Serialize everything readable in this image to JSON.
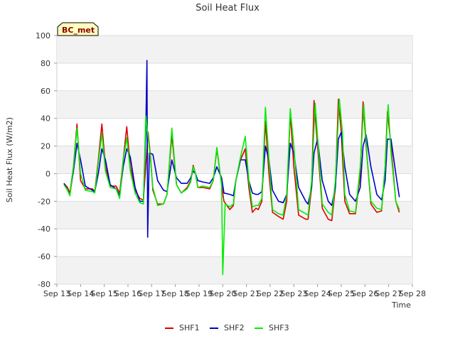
{
  "chart_data": {
    "type": "line",
    "title": "Soil Heat Flux",
    "xlabel": "Time",
    "ylabel": "Soil Heat Flux (W/m2)",
    "site_label": "BC_met",
    "xlim": [
      13,
      28
    ],
    "ylim": [
      -80,
      100
    ],
    "x_ticks": [
      {
        "x": 13,
        "label": "Sep 13"
      },
      {
        "x": 14,
        "label": "Sep 14"
      },
      {
        "x": 15,
        "label": "Sep 15"
      },
      {
        "x": 16,
        "label": "Sep 16"
      },
      {
        "x": 17,
        "label": "Sep 17"
      },
      {
        "x": 18,
        "label": "Sep 18"
      },
      {
        "x": 19,
        "label": "Sep 19"
      },
      {
        "x": 20,
        "label": "Sep 20"
      },
      {
        "x": 21,
        "label": "Sep 21"
      },
      {
        "x": 22,
        "label": "Sep 22"
      },
      {
        "x": 23,
        "label": "Sep 23"
      },
      {
        "x": 24,
        "label": "Sep 24"
      },
      {
        "x": 25,
        "label": "Sep 25"
      },
      {
        "x": 26,
        "label": "Sep 26"
      },
      {
        "x": 27,
        "label": "Sep 27"
      },
      {
        "x": 28,
        "label": "Sep 28"
      }
    ],
    "y_ticks": [
      {
        "y": -80,
        "label": "-80"
      },
      {
        "y": -60,
        "label": "-60"
      },
      {
        "y": -40,
        "label": "-40"
      },
      {
        "y": -20,
        "label": "-20"
      },
      {
        "y": 0,
        "label": "0"
      },
      {
        "y": 20,
        "label": "20"
      },
      {
        "y": 40,
        "label": "40"
      },
      {
        "y": 60,
        "label": "60"
      },
      {
        "y": 80,
        "label": "80"
      },
      {
        "y": 100,
        "label": "100"
      }
    ],
    "grid": true,
    "legend_position": "bottom-center",
    "series": [
      {
        "name": "SHF1",
        "color": "#dd0000",
        "points": [
          [
            13.3,
            -7
          ],
          [
            13.45,
            -10
          ],
          [
            13.55,
            -14
          ],
          [
            13.7,
            5
          ],
          [
            13.85,
            36
          ],
          [
            14.0,
            -5
          ],
          [
            14.2,
            -11
          ],
          [
            14.5,
            -11
          ],
          [
            14.6,
            -13
          ],
          [
            14.75,
            10
          ],
          [
            14.9,
            36
          ],
          [
            15.05,
            5
          ],
          [
            15.25,
            -9
          ],
          [
            15.5,
            -9
          ],
          [
            15.65,
            -14
          ],
          [
            15.8,
            10
          ],
          [
            15.95,
            34
          ],
          [
            16.1,
            5
          ],
          [
            16.3,
            -12
          ],
          [
            16.5,
            -18
          ],
          [
            16.65,
            -19
          ],
          [
            16.75,
            5
          ],
          [
            16.85,
            30
          ],
          [
            16.95,
            12
          ],
          [
            17.05,
            -12
          ],
          [
            17.25,
            -22
          ],
          [
            17.5,
            -22
          ],
          [
            17.65,
            -15
          ],
          [
            17.85,
            28
          ],
          [
            18.05,
            -8
          ],
          [
            18.25,
            -14
          ],
          [
            18.5,
            -10
          ],
          [
            18.65,
            -5
          ],
          [
            18.75,
            6
          ],
          [
            18.85,
            0
          ],
          [
            18.95,
            -10
          ],
          [
            19.15,
            -10
          ],
          [
            19.45,
            -11
          ],
          [
            19.6,
            -5
          ],
          [
            19.75,
            18
          ],
          [
            19.95,
            -8
          ],
          [
            20.05,
            -20
          ],
          [
            20.3,
            -26
          ],
          [
            20.45,
            -23
          ],
          [
            20.55,
            -5
          ],
          [
            20.75,
            10
          ],
          [
            20.95,
            18
          ],
          [
            21.1,
            -10
          ],
          [
            21.25,
            -28
          ],
          [
            21.4,
            -25
          ],
          [
            21.5,
            -26
          ],
          [
            21.65,
            -20
          ],
          [
            21.8,
            38
          ],
          [
            21.95,
            0
          ],
          [
            22.1,
            -28
          ],
          [
            22.35,
            -31
          ],
          [
            22.55,
            -33
          ],
          [
            22.7,
            -20
          ],
          [
            22.85,
            44
          ],
          [
            23.0,
            5
          ],
          [
            23.2,
            -30
          ],
          [
            23.5,
            -33
          ],
          [
            23.6,
            -33
          ],
          [
            23.75,
            -10
          ],
          [
            23.85,
            53
          ],
          [
            24.0,
            20
          ],
          [
            24.2,
            -25
          ],
          [
            24.45,
            -33
          ],
          [
            24.6,
            -34
          ],
          [
            24.75,
            -10
          ],
          [
            24.88,
            54
          ],
          [
            25.0,
            30
          ],
          [
            25.15,
            -20
          ],
          [
            25.35,
            -29
          ],
          [
            25.6,
            -29
          ],
          [
            25.8,
            0
          ],
          [
            25.92,
            52
          ],
          [
            26.05,
            20
          ],
          [
            26.25,
            -22
          ],
          [
            26.5,
            -28
          ],
          [
            26.7,
            -27
          ],
          [
            26.85,
            5
          ],
          [
            26.95,
            45
          ],
          [
            27.1,
            20
          ],
          [
            27.3,
            -20
          ],
          [
            27.45,
            -28
          ]
        ]
      },
      {
        "name": "SHF2",
        "color": "#0000cc",
        "points": [
          [
            13.3,
            -7
          ],
          [
            13.45,
            -12
          ],
          [
            13.55,
            -15
          ],
          [
            13.7,
            2
          ],
          [
            13.85,
            22
          ],
          [
            14.0,
            10
          ],
          [
            14.2,
            -9
          ],
          [
            14.5,
            -12
          ],
          [
            14.6,
            -13
          ],
          [
            14.75,
            0
          ],
          [
            14.9,
            18
          ],
          [
            15.05,
            10
          ],
          [
            15.25,
            -8
          ],
          [
            15.5,
            -11
          ],
          [
            15.65,
            -16
          ],
          [
            15.8,
            5
          ],
          [
            15.95,
            18
          ],
          [
            16.1,
            12
          ],
          [
            16.3,
            -10
          ],
          [
            16.5,
            -20
          ],
          [
            16.65,
            -20
          ],
          [
            16.75,
            30
          ],
          [
            16.8,
            82
          ],
          [
            16.83,
            -46
          ],
          [
            16.9,
            15
          ],
          [
            17.05,
            14
          ],
          [
            17.25,
            -5
          ],
          [
            17.5,
            -12
          ],
          [
            17.65,
            -13
          ],
          [
            17.85,
            10
          ],
          [
            18.05,
            -3
          ],
          [
            18.25,
            -7
          ],
          [
            18.5,
            -7
          ],
          [
            18.65,
            -3
          ],
          [
            18.75,
            2
          ],
          [
            18.85,
            0
          ],
          [
            18.95,
            -5
          ],
          [
            19.15,
            -6
          ],
          [
            19.45,
            -7
          ],
          [
            19.6,
            -3
          ],
          [
            19.75,
            5
          ],
          [
            19.95,
            -3
          ],
          [
            20.05,
            -14
          ],
          [
            20.3,
            -15
          ],
          [
            20.45,
            -16
          ],
          [
            20.55,
            -5
          ],
          [
            20.75,
            10
          ],
          [
            20.95,
            10
          ],
          [
            21.1,
            -5
          ],
          [
            21.25,
            -14
          ],
          [
            21.4,
            -15
          ],
          [
            21.5,
            -15
          ],
          [
            21.65,
            -13
          ],
          [
            21.8,
            20
          ],
          [
            21.95,
            10
          ],
          [
            22.1,
            -12
          ],
          [
            22.35,
            -20
          ],
          [
            22.55,
            -21
          ],
          [
            22.7,
            -15
          ],
          [
            22.85,
            22
          ],
          [
            23.0,
            15
          ],
          [
            23.2,
            -10
          ],
          [
            23.5,
            -20
          ],
          [
            23.6,
            -22
          ],
          [
            23.75,
            -10
          ],
          [
            23.85,
            15
          ],
          [
            24.0,
            25
          ],
          [
            24.2,
            -5
          ],
          [
            24.45,
            -20
          ],
          [
            24.6,
            -23
          ],
          [
            24.75,
            -10
          ],
          [
            24.88,
            25
          ],
          [
            25.0,
            30
          ],
          [
            25.15,
            5
          ],
          [
            25.35,
            -15
          ],
          [
            25.6,
            -20
          ],
          [
            25.8,
            -10
          ],
          [
            25.92,
            20
          ],
          [
            26.05,
            28
          ],
          [
            26.25,
            5
          ],
          [
            26.5,
            -15
          ],
          [
            26.7,
            -19
          ],
          [
            26.85,
            -5
          ],
          [
            26.95,
            25
          ],
          [
            27.1,
            25
          ],
          [
            27.3,
            0
          ],
          [
            27.45,
            -17
          ]
        ]
      },
      {
        "name": "SHF3",
        "color": "#00ee00",
        "points": [
          [
            13.3,
            -8
          ],
          [
            13.45,
            -12
          ],
          [
            13.55,
            -16
          ],
          [
            13.7,
            5
          ],
          [
            13.85,
            33
          ],
          [
            14.0,
            0
          ],
          [
            14.2,
            -12
          ],
          [
            14.5,
            -13
          ],
          [
            14.6,
            -14
          ],
          [
            14.75,
            8
          ],
          [
            14.9,
            29
          ],
          [
            15.05,
            2
          ],
          [
            15.25,
            -10
          ],
          [
            15.5,
            -11
          ],
          [
            15.65,
            -18
          ],
          [
            15.8,
            10
          ],
          [
            15.95,
            26
          ],
          [
            16.1,
            2
          ],
          [
            16.3,
            -14
          ],
          [
            16.5,
            -21
          ],
          [
            16.65,
            -22
          ],
          [
            16.75,
            42
          ],
          [
            16.85,
            27
          ],
          [
            16.95,
            10
          ],
          [
            17.05,
            -10
          ],
          [
            17.25,
            -23
          ],
          [
            17.5,
            -22
          ],
          [
            17.65,
            -15
          ],
          [
            17.85,
            33
          ],
          [
            18.05,
            -8
          ],
          [
            18.25,
            -14
          ],
          [
            18.5,
            -11
          ],
          [
            18.65,
            -6
          ],
          [
            18.75,
            5
          ],
          [
            18.85,
            0
          ],
          [
            18.95,
            -10
          ],
          [
            19.15,
            -9
          ],
          [
            19.45,
            -10
          ],
          [
            19.6,
            -5
          ],
          [
            19.75,
            19
          ],
          [
            19.95,
            -8
          ],
          [
            20.0,
            -73
          ],
          [
            20.1,
            -22
          ],
          [
            20.3,
            -24
          ],
          [
            20.45,
            -22
          ],
          [
            20.55,
            -5
          ],
          [
            20.75,
            12
          ],
          [
            20.95,
            27
          ],
          [
            21.1,
            -5
          ],
          [
            21.25,
            -24
          ],
          [
            21.4,
            -23
          ],
          [
            21.5,
            -23
          ],
          [
            21.65,
            -18
          ],
          [
            21.8,
            48
          ],
          [
            21.95,
            10
          ],
          [
            22.1,
            -26
          ],
          [
            22.35,
            -29
          ],
          [
            22.55,
            -30
          ],
          [
            22.7,
            -15
          ],
          [
            22.85,
            47
          ],
          [
            23.0,
            20
          ],
          [
            23.2,
            -26
          ],
          [
            23.5,
            -29
          ],
          [
            23.6,
            -30
          ],
          [
            23.75,
            -5
          ],
          [
            23.9,
            51
          ],
          [
            24.05,
            15
          ],
          [
            24.2,
            -22
          ],
          [
            24.45,
            -28
          ],
          [
            24.6,
            -30
          ],
          [
            24.75,
            -5
          ],
          [
            24.92,
            54
          ],
          [
            25.05,
            30
          ],
          [
            25.15,
            -15
          ],
          [
            25.35,
            -27
          ],
          [
            25.6,
            -28
          ],
          [
            25.8,
            5
          ],
          [
            25.95,
            50
          ],
          [
            26.1,
            10
          ],
          [
            26.25,
            -20
          ],
          [
            26.5,
            -25
          ],
          [
            26.7,
            -26
          ],
          [
            26.85,
            5
          ],
          [
            26.98,
            50
          ],
          [
            27.1,
            15
          ],
          [
            27.3,
            -20
          ],
          [
            27.45,
            -26
          ]
        ]
      }
    ]
  }
}
